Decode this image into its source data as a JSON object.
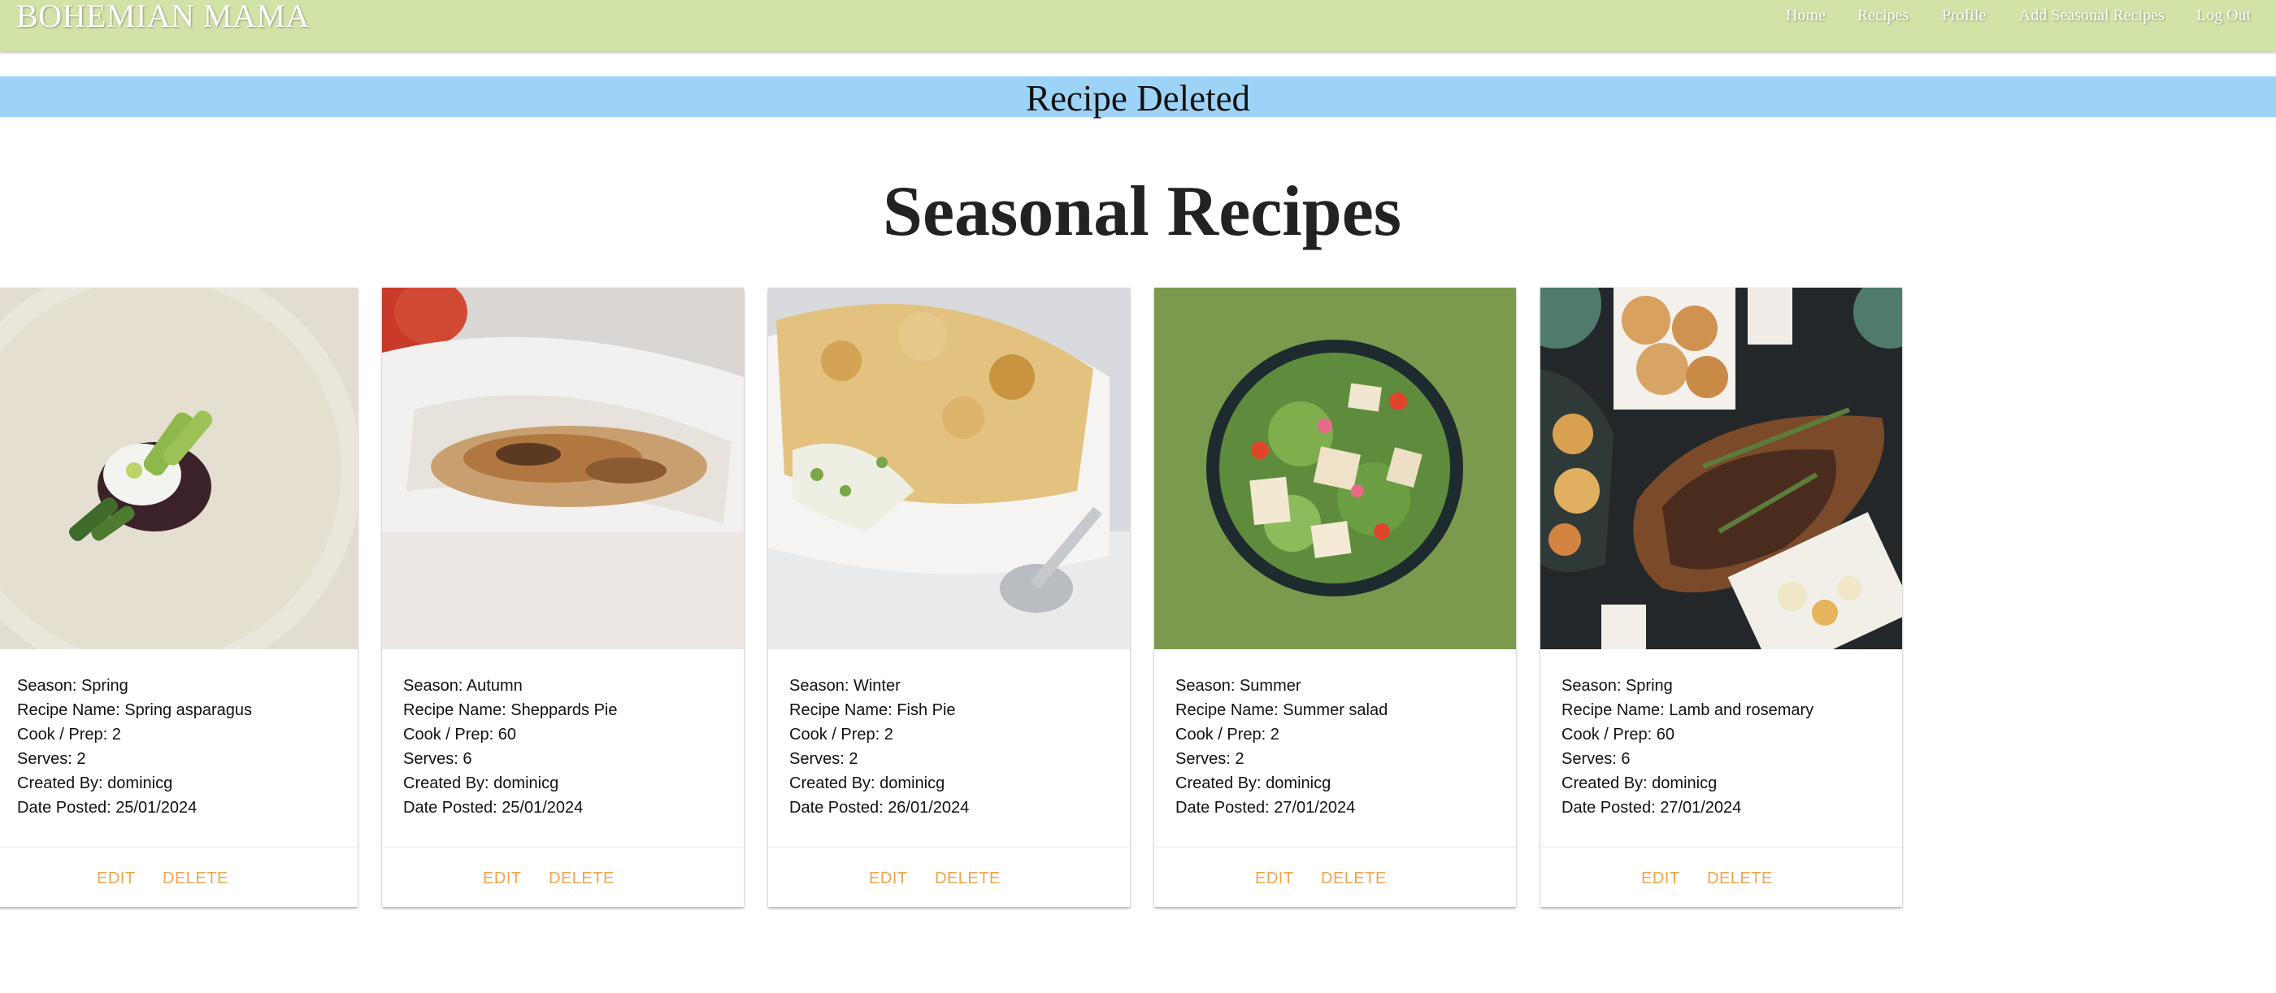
{
  "navbar": {
    "brand": "BOHEMIAN MAMA",
    "links": [
      "Home",
      "Recipes",
      "Profile",
      "Add Seasonal Recipes",
      "Log Out"
    ]
  },
  "alert": {
    "message": "Recipe Deleted"
  },
  "page": {
    "title": "Seasonal Recipes"
  },
  "labels": {
    "season": "Season:",
    "recipe_name": "Recipe Name:",
    "cook_prep": "Cook / Prep:",
    "serves": "Serves:",
    "created_by": "Created By:",
    "date_posted": "Date Posted:",
    "edit": "EDIT",
    "delete": "DELETE"
  },
  "recipes": [
    {
      "season": "Spring",
      "recipe_name": "Spring asparagus",
      "cook_prep": "2",
      "serves": "2",
      "created_by": "dominicg",
      "date_posted": "25/01/2024",
      "image_icon": "asparagus-dish-photo"
    },
    {
      "season": "Autumn",
      "recipe_name": "Sheppards Pie",
      "cook_prep": "60",
      "serves": "6",
      "created_by": "dominicg",
      "date_posted": "25/01/2024",
      "image_icon": "baked-pie-photo"
    },
    {
      "season": "Winter",
      "recipe_name": "Fish Pie",
      "cook_prep": "2",
      "serves": "2",
      "created_by": "dominicg",
      "date_posted": "26/01/2024",
      "image_icon": "fish-pie-photo"
    },
    {
      "season": "Summer",
      "recipe_name": "Summer salad",
      "cook_prep": "2",
      "serves": "2",
      "created_by": "dominicg",
      "date_posted": "27/01/2024",
      "image_icon": "salad-bowl-photo"
    },
    {
      "season": "Spring",
      "recipe_name": "Lamb and rosemary",
      "cook_prep": "60",
      "serves": "6",
      "created_by": "dominicg",
      "date_posted": "27/01/2024",
      "image_icon": "roast-lamb-photo"
    }
  ],
  "colors": {
    "navbar": "#d2e3a8",
    "alert": "#9ed3f8",
    "action": "#f0a44c"
  }
}
